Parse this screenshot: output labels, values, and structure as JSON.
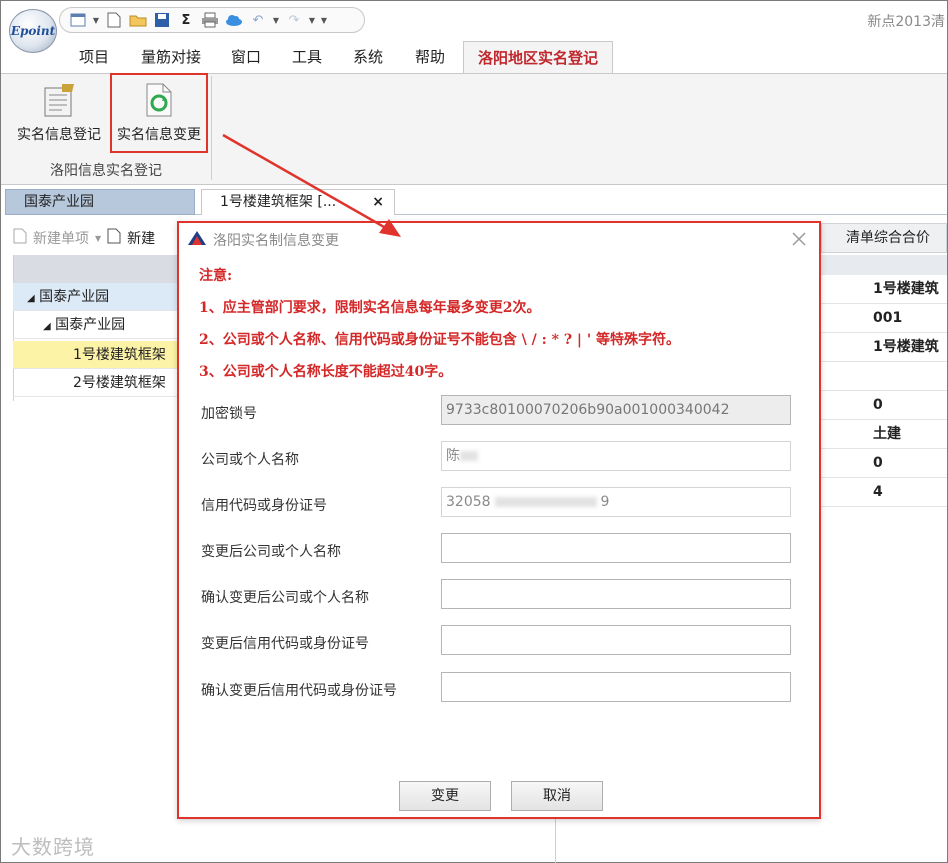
{
  "app": {
    "title": "新点2013清",
    "logo_text": "Epoint"
  },
  "ribbon": {
    "tabs": [
      "项目",
      "量筋对接",
      "窗口",
      "工具",
      "系统",
      "帮助",
      "洛阳地区实名登记"
    ],
    "buttons": {
      "register": "实名信息登记",
      "change": "实名信息变更"
    },
    "group_label": "洛阳信息实名登记"
  },
  "doc_tabs": {
    "tab1": "国泰产业园",
    "tab2": "1号楼建筑框架 [..."
  },
  "left_panel": {
    "toolbar": {
      "new_item": "新建单项",
      "new2": "新建"
    },
    "tree": [
      "国泰产业园",
      "国泰产业园",
      "1号楼建筑框架",
      "2号楼建筑框架"
    ]
  },
  "right_grid": {
    "header": "清单综合合价",
    "cells": [
      "1号楼建筑",
      "001",
      "1号楼建筑",
      "",
      "0",
      "土建",
      "0",
      "4"
    ]
  },
  "dialog": {
    "title": "洛阳实名制信息变更",
    "notice": {
      "heading": "注意:",
      "line1": "1、应主管部门要求，限制实名信息每年最多变更2次。",
      "line2": "2、公司或个人名称、信用代码或身份证号不能包含 \\ / : * ? | ' 等特殊字符。",
      "line3": "3、公司或个人名称长度不能超过40字。"
    },
    "fields": {
      "lock_no": {
        "label": "加密锁号",
        "value": "9733c80100070206b90a001000340042"
      },
      "name": {
        "label": "公司或个人名称",
        "value": "陈"
      },
      "credit": {
        "label": "信用代码或身份证号",
        "value_prefix": "32058",
        "value_suffix": "9"
      },
      "new_name": {
        "label": "变更后公司或个人名称",
        "value": ""
      },
      "confirm_name": {
        "label": "确认变更后公司或个人名称",
        "value": ""
      },
      "new_credit": {
        "label": "变更后信用代码或身份证号",
        "value": ""
      },
      "confirm_credit": {
        "label": "确认变更后信用代码或身份证号",
        "value": ""
      }
    },
    "buttons": {
      "ok": "变更",
      "cancel": "取消"
    }
  },
  "watermark": "大数跨境",
  "colors": {
    "accent_red": "#e0332c",
    "notice_red": "#d42727",
    "tab_active_text": "#c0282e"
  }
}
